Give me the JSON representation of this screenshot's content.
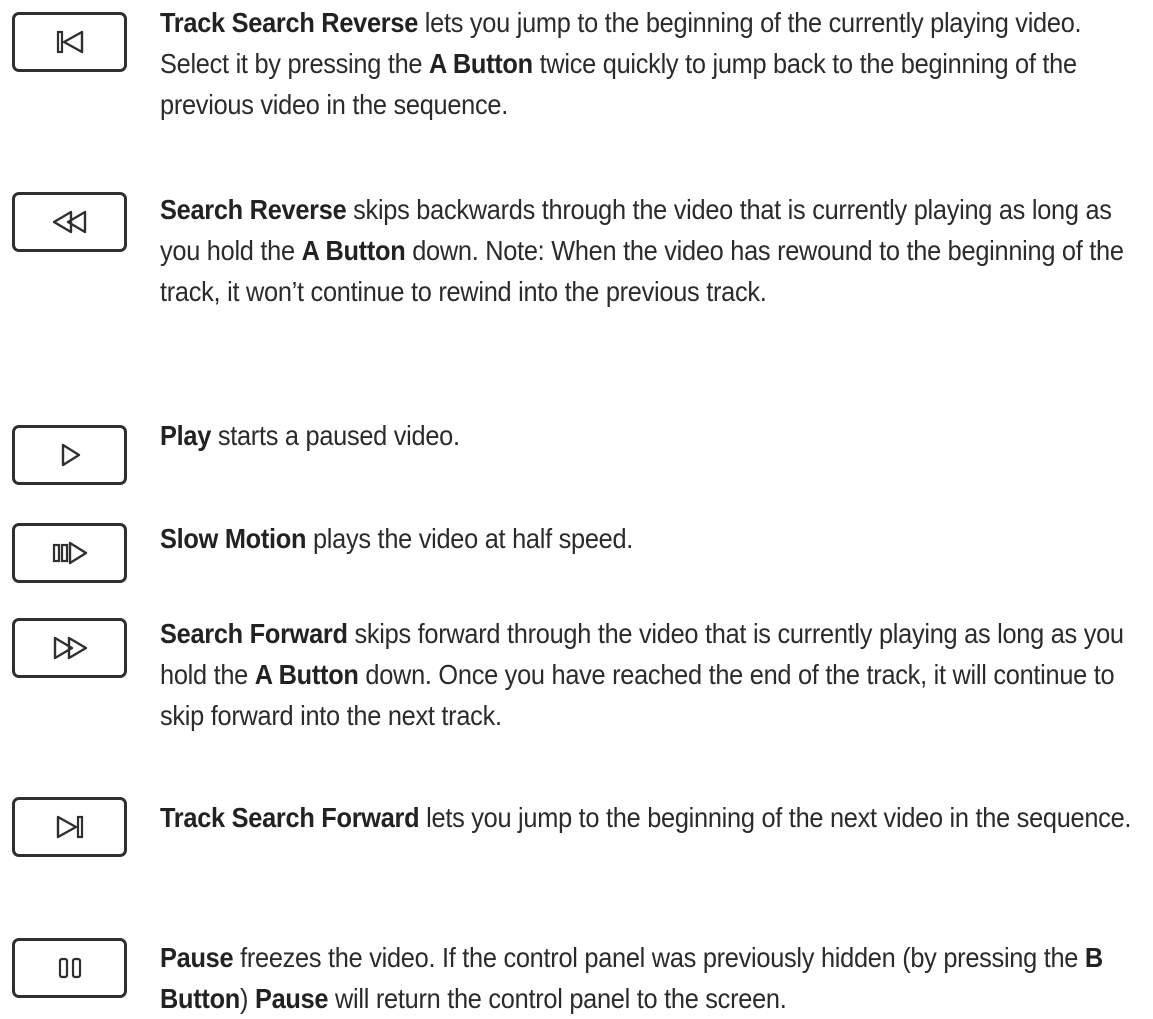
{
  "entries": [
    {
      "id": "track-search-reverse",
      "icon": "track-search-reverse-icon",
      "parts": [
        {
          "t": "Track Search Reverse",
          "b": true
        },
        {
          "t": " lets you jump to the beginning of the currently playing video. Select it by pressing the ",
          "b": false
        },
        {
          "t": "A Button",
          "b": true
        },
        {
          "t": " twice quickly to jump back to the beginning of the previous video in the sequence.",
          "b": false
        }
      ]
    },
    {
      "id": "search-reverse",
      "icon": "search-reverse-icon",
      "parts": [
        {
          "t": "Search Reverse",
          "b": true
        },
        {
          "t": " skips backwards through the video that is currently playing as long as you hold the ",
          "b": false
        },
        {
          "t": "A Button",
          "b": true
        },
        {
          "t": " down. Note: When the video has rewound to the beginning of the track, it won’t continue to rewind into the previous track.",
          "b": false
        }
      ]
    },
    {
      "id": "play",
      "icon": "play-icon",
      "parts": [
        {
          "t": "Play",
          "b": true
        },
        {
          "t": " starts a paused video.",
          "b": false
        }
      ]
    },
    {
      "id": "slow-motion",
      "icon": "slow-motion-icon",
      "parts": [
        {
          "t": "Slow Motion",
          "b": true
        },
        {
          "t": " plays the video at half speed.",
          "b": false
        }
      ]
    },
    {
      "id": "search-forward",
      "icon": "search-forward-icon",
      "parts": [
        {
          "t": "Search Forward",
          "b": true
        },
        {
          "t": " skips forward through the video that is currently playing as long as you hold the ",
          "b": false
        },
        {
          "t": "A Button",
          "b": true
        },
        {
          "t": " down. Once you have reached the end of the track, it will continue to skip forward into the next track.",
          "b": false
        }
      ]
    },
    {
      "id": "track-search-forward",
      "icon": "track-search-forward-icon",
      "parts": [
        {
          "t": "Track Search Forward",
          "b": true
        },
        {
          "t": " lets you jump to the beginning of the next video in the sequence.",
          "b": false
        }
      ]
    },
    {
      "id": "pause",
      "icon": "pause-icon",
      "parts": [
        {
          "t": "Pause",
          "b": true
        },
        {
          "t": " freezes the video. If the control panel was previously hidden (by pressing the ",
          "b": false
        },
        {
          "t": "B Button",
          "b": true
        },
        {
          "t": ") ",
          "b": false
        },
        {
          "t": "Pause",
          "b": true
        },
        {
          "t": " will return the control panel to the screen.",
          "b": false
        }
      ]
    }
  ]
}
